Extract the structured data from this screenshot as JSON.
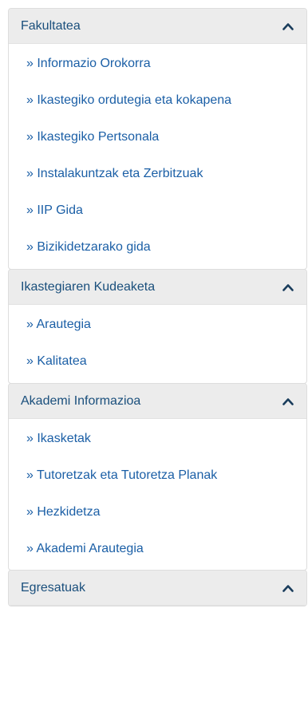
{
  "sections": [
    {
      "title": "Fakultatea",
      "items": [
        "» Informazio Orokorra",
        "» Ikastegiko ordutegia eta kokapena",
        "» Ikastegiko Pertsonala",
        "» Instalakuntzak eta Zerbitzuak",
        "» IIP Gida",
        "» Bizikidetzarako gida"
      ]
    },
    {
      "title": "Ikastegiaren Kudeaketa",
      "items": [
        "» Arautegia",
        "» Kalitatea"
      ]
    },
    {
      "title": "Akademi Informazioa",
      "items": [
        "» Ikasketak",
        "» Tutoretzak eta Tutoretza Planak",
        "» Hezkidetza",
        "» Akademi Arautegia"
      ]
    },
    {
      "title": "Egresatuak",
      "items": []
    }
  ],
  "icons": {
    "toggle": "chevron-up-icon"
  },
  "colors": {
    "header_bg": "#ececec",
    "header_text": "#1a4f7c",
    "link": "#1b5fa6",
    "border": "#dddddd"
  }
}
